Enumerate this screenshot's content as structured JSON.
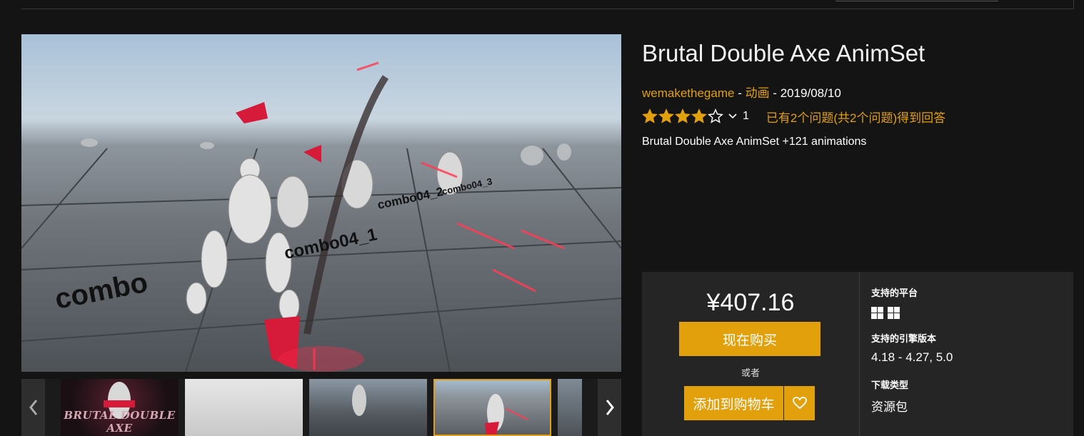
{
  "product": {
    "title": "Brutal Double Axe AnimSet",
    "seller": "wemakethegame",
    "separator_1": " - ",
    "category": "动画",
    "separator_2": " - ",
    "release_date": "2019/08/10",
    "rating": {
      "stars": 4,
      "max_stars": 5,
      "count": "1"
    },
    "qa_text": "已有2个问题(共2个问题)得到回答",
    "description": "Brutal Double Axe AnimSet +121 animations"
  },
  "hero": {
    "scene_labels": [
      "combo",
      "combo04_1",
      "combo04_2",
      "combo04_3"
    ]
  },
  "thumbnails": {
    "items": [
      {
        "caption": "BRUTAL DOUBLE AXE"
      },
      {
        "caption": ""
      },
      {
        "caption": ""
      },
      {
        "caption": "",
        "selected": true
      },
      {
        "caption": ""
      }
    ],
    "prev_icon": "chevron-left-icon",
    "next_icon": "chevron-right-icon"
  },
  "purchase": {
    "price": "¥407.16",
    "buy_now_label": "现在购买",
    "or_label": "或者",
    "add_to_cart_label": "添加到购物车",
    "wishlist_icon": "heart-icon"
  },
  "specs": {
    "platform_heading": "支持的平台",
    "platform_icons": [
      "windows-icon",
      "windows-icon"
    ],
    "engine_heading": "支持的引擎版本",
    "engine_versions": "4.18 - 4.27, 5.0",
    "download_heading": "下载类型",
    "download_type": "资源包"
  },
  "colors": {
    "accent": "#e2a00c",
    "background": "#141414",
    "panel": "#252525"
  }
}
